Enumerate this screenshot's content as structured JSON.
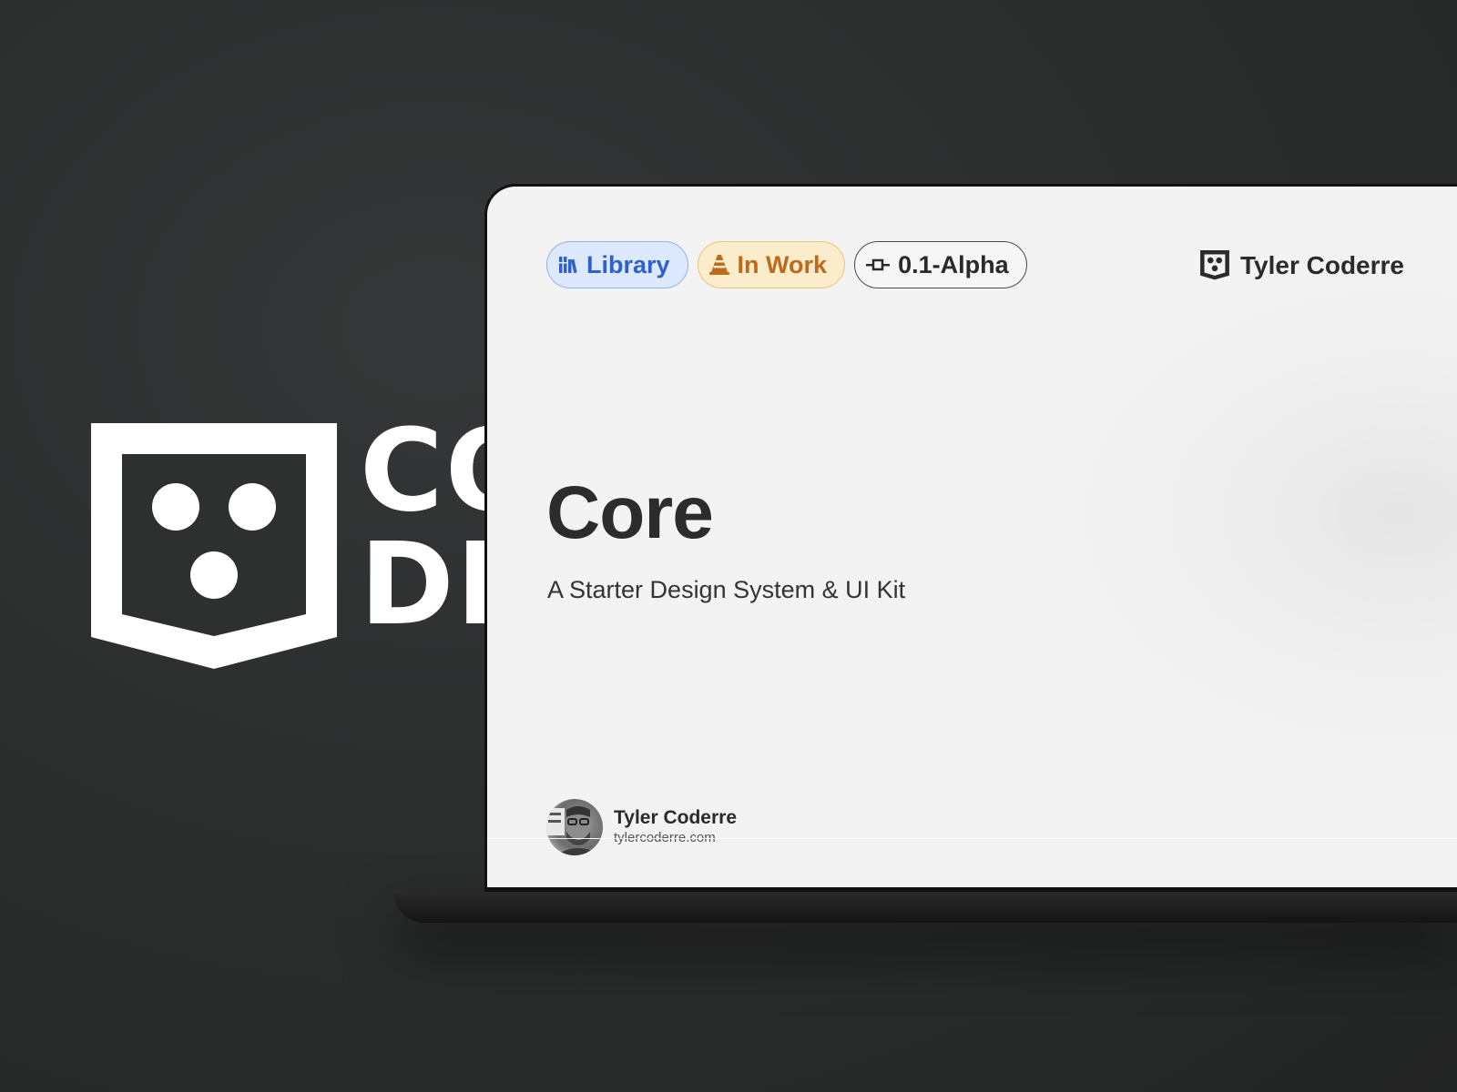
{
  "background": {
    "color": "#2c2e2e",
    "logo_icon": "shield-face-logo-icon",
    "wordmark_lines": [
      "CO",
      "DE"
    ]
  },
  "screen": {
    "chips": [
      {
        "label": "Library",
        "icon": "books-icon",
        "color": "#2f62c9",
        "bg": "#dce9ff"
      },
      {
        "label": "In Work",
        "icon": "traffic-cone-icon",
        "color": "#bd6a1c",
        "bg": "#fbeccb"
      },
      {
        "label": "0.1-Alpha",
        "icon": "commit-icon",
        "color": "#2a2a2a",
        "bg": "#f6f6f6"
      }
    ],
    "brand": {
      "name": "Tyler Coderre",
      "icon": "shield-face-logo-icon"
    },
    "title": "Core",
    "subtitle": "A Starter Design System & UI Kit",
    "author": {
      "name": "Tyler Coderre",
      "website": "tylercoderre.com",
      "avatar": "avatar-photo"
    }
  }
}
